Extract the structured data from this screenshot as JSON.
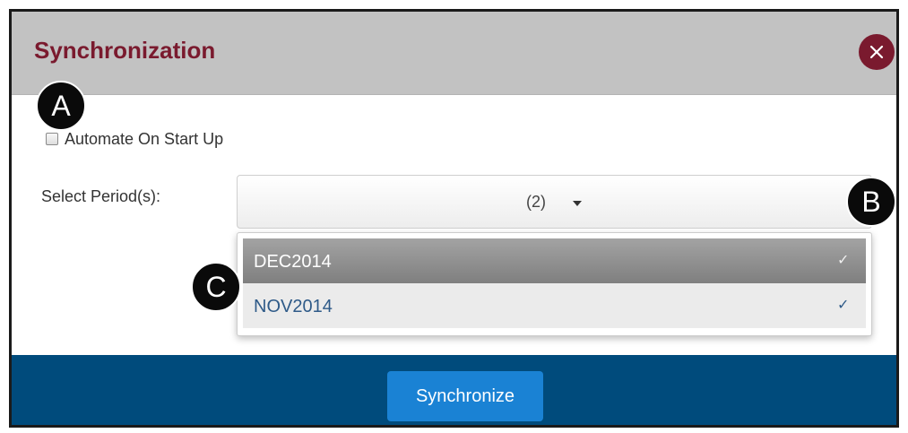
{
  "dialog": {
    "title": "Synchronization",
    "close_icon": "close-x-icon"
  },
  "automate": {
    "label": "Automate On Start Up",
    "checked": false
  },
  "period": {
    "label": "Select Period(s):",
    "selected_count": "(2)",
    "options": [
      {
        "label": "DEC2014",
        "check": "✓",
        "selected": true
      },
      {
        "label": "NOV2014",
        "check": "✓",
        "selected": true
      }
    ]
  },
  "footer": {
    "synchronize_label": "Synchronize"
  },
  "markers": {
    "a": "A",
    "b": "B",
    "c": "C"
  },
  "colors": {
    "title": "#7a1a2e",
    "close_button": "#7a1a2e",
    "header_bg": "#c2c2c2",
    "footer_bg": "#004b7c",
    "primary_button": "#1a82d4",
    "option_text": "#2e5a88"
  }
}
